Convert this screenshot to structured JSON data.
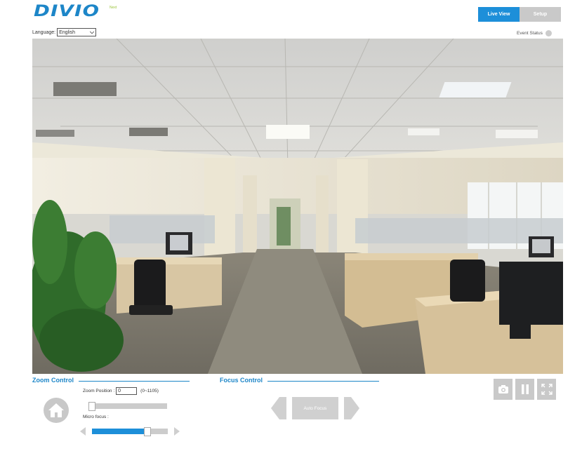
{
  "brand": {
    "logo_text": "DIVIO",
    "logo_sub": "Next"
  },
  "language": {
    "label": "Language:",
    "selected": "English"
  },
  "tabs": [
    {
      "label": "Live View",
      "active": true
    },
    {
      "label": "Setup",
      "active": false
    }
  ],
  "event_status": {
    "label": "Event Status"
  },
  "zoom_control": {
    "title": "Zoom Control",
    "position_label": "Zoom Position :",
    "position_value": "0",
    "position_range": "(0~1105)",
    "position_level": 0.0,
    "micro_focus_label": "Micro focus :",
    "micro_focus_level": 0.73
  },
  "focus_control": {
    "title": "Focus Control",
    "auto_focus_label": "Auto Focus"
  },
  "icons": {
    "home": "home-icon",
    "snapshot": "camera-icon",
    "pause": "pause-icon",
    "fullscreen": "fullscreen-icon",
    "left": "chevron-left-icon",
    "right": "chevron-right-icon"
  },
  "colors": {
    "accent": "#1d8fd9",
    "logo": "#1d86c8",
    "button_gray": "#c9c9c9"
  }
}
